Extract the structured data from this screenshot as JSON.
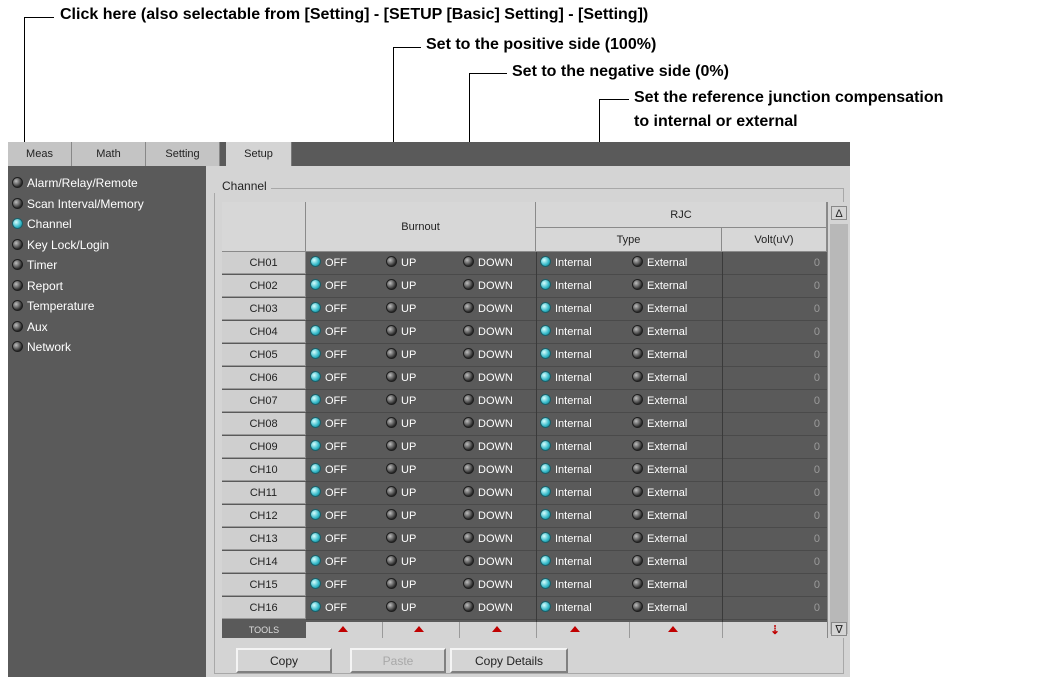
{
  "callouts": {
    "click_here": "Click here (also selectable from [Setting] - [SETUP [Basic] Setting] - [Setting])",
    "positive": "Set to the positive side (100%)",
    "negative": "Set to the negative side (0%)",
    "rjc_line1": "Set the reference junction compensation",
    "rjc_line2": "to internal or external"
  },
  "tabs": [
    "Meas",
    "Math",
    "Setting",
    "Setup"
  ],
  "active_tab": "Setup",
  "sidebar": {
    "items": [
      {
        "label": "Alarm/Relay/Remote",
        "active": false
      },
      {
        "label": "Scan Interval/Memory",
        "active": false
      },
      {
        "label": "Channel",
        "active": true
      },
      {
        "label": "Key Lock/Login",
        "active": false
      },
      {
        "label": "Timer",
        "active": false
      },
      {
        "label": "Report",
        "active": false
      },
      {
        "label": "Temperature",
        "active": false
      },
      {
        "label": "Aux",
        "active": false
      },
      {
        "label": "Network",
        "active": false
      }
    ]
  },
  "group_title": "Channel",
  "table": {
    "burnout_header": "Burnout",
    "rjc_header": "RJC",
    "type_header": "Type",
    "volt_header": "Volt(uV)",
    "burnout_options": [
      "OFF",
      "UP",
      "DOWN"
    ],
    "rjc_options": [
      "Internal",
      "External"
    ],
    "tools_label": "TOOLS",
    "rows": [
      {
        "ch": "CH01",
        "burnout": "OFF",
        "rjc": "Internal",
        "volt": "0"
      },
      {
        "ch": "CH02",
        "burnout": "OFF",
        "rjc": "Internal",
        "volt": "0"
      },
      {
        "ch": "CH03",
        "burnout": "OFF",
        "rjc": "Internal",
        "volt": "0"
      },
      {
        "ch": "CH04",
        "burnout": "OFF",
        "rjc": "Internal",
        "volt": "0"
      },
      {
        "ch": "CH05",
        "burnout": "OFF",
        "rjc": "Internal",
        "volt": "0"
      },
      {
        "ch": "CH06",
        "burnout": "OFF",
        "rjc": "Internal",
        "volt": "0"
      },
      {
        "ch": "CH07",
        "burnout": "OFF",
        "rjc": "Internal",
        "volt": "0"
      },
      {
        "ch": "CH08",
        "burnout": "OFF",
        "rjc": "Internal",
        "volt": "0"
      },
      {
        "ch": "CH09",
        "burnout": "OFF",
        "rjc": "Internal",
        "volt": "0"
      },
      {
        "ch": "CH10",
        "burnout": "OFF",
        "rjc": "Internal",
        "volt": "0"
      },
      {
        "ch": "CH11",
        "burnout": "OFF",
        "rjc": "Internal",
        "volt": "0"
      },
      {
        "ch": "CH12",
        "burnout": "OFF",
        "rjc": "Internal",
        "volt": "0"
      },
      {
        "ch": "CH13",
        "burnout": "OFF",
        "rjc": "Internal",
        "volt": "0"
      },
      {
        "ch": "CH14",
        "burnout": "OFF",
        "rjc": "Internal",
        "volt": "0"
      },
      {
        "ch": "CH15",
        "burnout": "OFF",
        "rjc": "Internal",
        "volt": "0"
      },
      {
        "ch": "CH16",
        "burnout": "OFF",
        "rjc": "Internal",
        "volt": "0"
      }
    ]
  },
  "buttons": {
    "copy": "Copy",
    "paste": "Paste",
    "copy_details": "Copy Details"
  },
  "scroll": {
    "up": "Δ",
    "down": "∇"
  },
  "icons": {
    "led_on": "led-on-icon",
    "led_off": "led-off-icon",
    "sort": "sort-triangle-icon"
  }
}
